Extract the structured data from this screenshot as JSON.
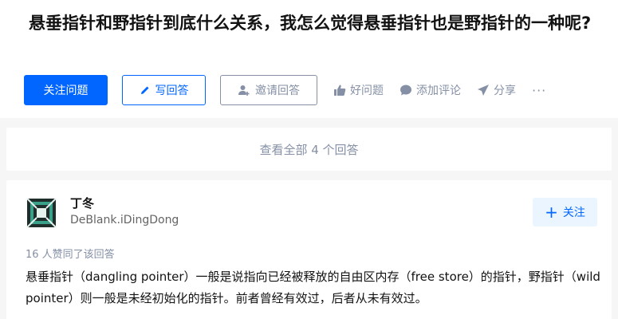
{
  "question": {
    "title": "悬垂指针和野指针到底什么关系，我怎么觉得悬垂指针也是野指针的一种呢?"
  },
  "actions": {
    "follow_label": "关注问题",
    "write_answer_label": "写回答",
    "invite_label": "邀请回答",
    "good_question_label": "好问题",
    "comment_label": "添加评论",
    "share_label": "分享",
    "more_label": "···"
  },
  "view_all": {
    "label": "查看全部 4 个回答"
  },
  "answer": {
    "author_name": "丁冬",
    "author_bio": "DeBlank.iDingDong",
    "follow_label": "关注",
    "votes_text": "16 人赞同了该回答",
    "content": "悬垂指针（dangling pointer）一般是说指向已经被释放的自由区内存（free store）的指针，野指针（wild pointer）则一般是未经初始化的指针。前者曾经有效过，后者从未有效过。"
  },
  "icons": {
    "write": "pencil-icon",
    "invite": "invite-user-icon",
    "good_question": "thumb-up-icon",
    "comment": "comment-bubble-icon",
    "share": "paper-plane-icon",
    "follow": "plus-icon"
  },
  "colors": {
    "primary": "#0066ff",
    "muted": "#8590a6",
    "follow_bg": "#ebf5ff",
    "page_bg": "#f6f6f6"
  }
}
